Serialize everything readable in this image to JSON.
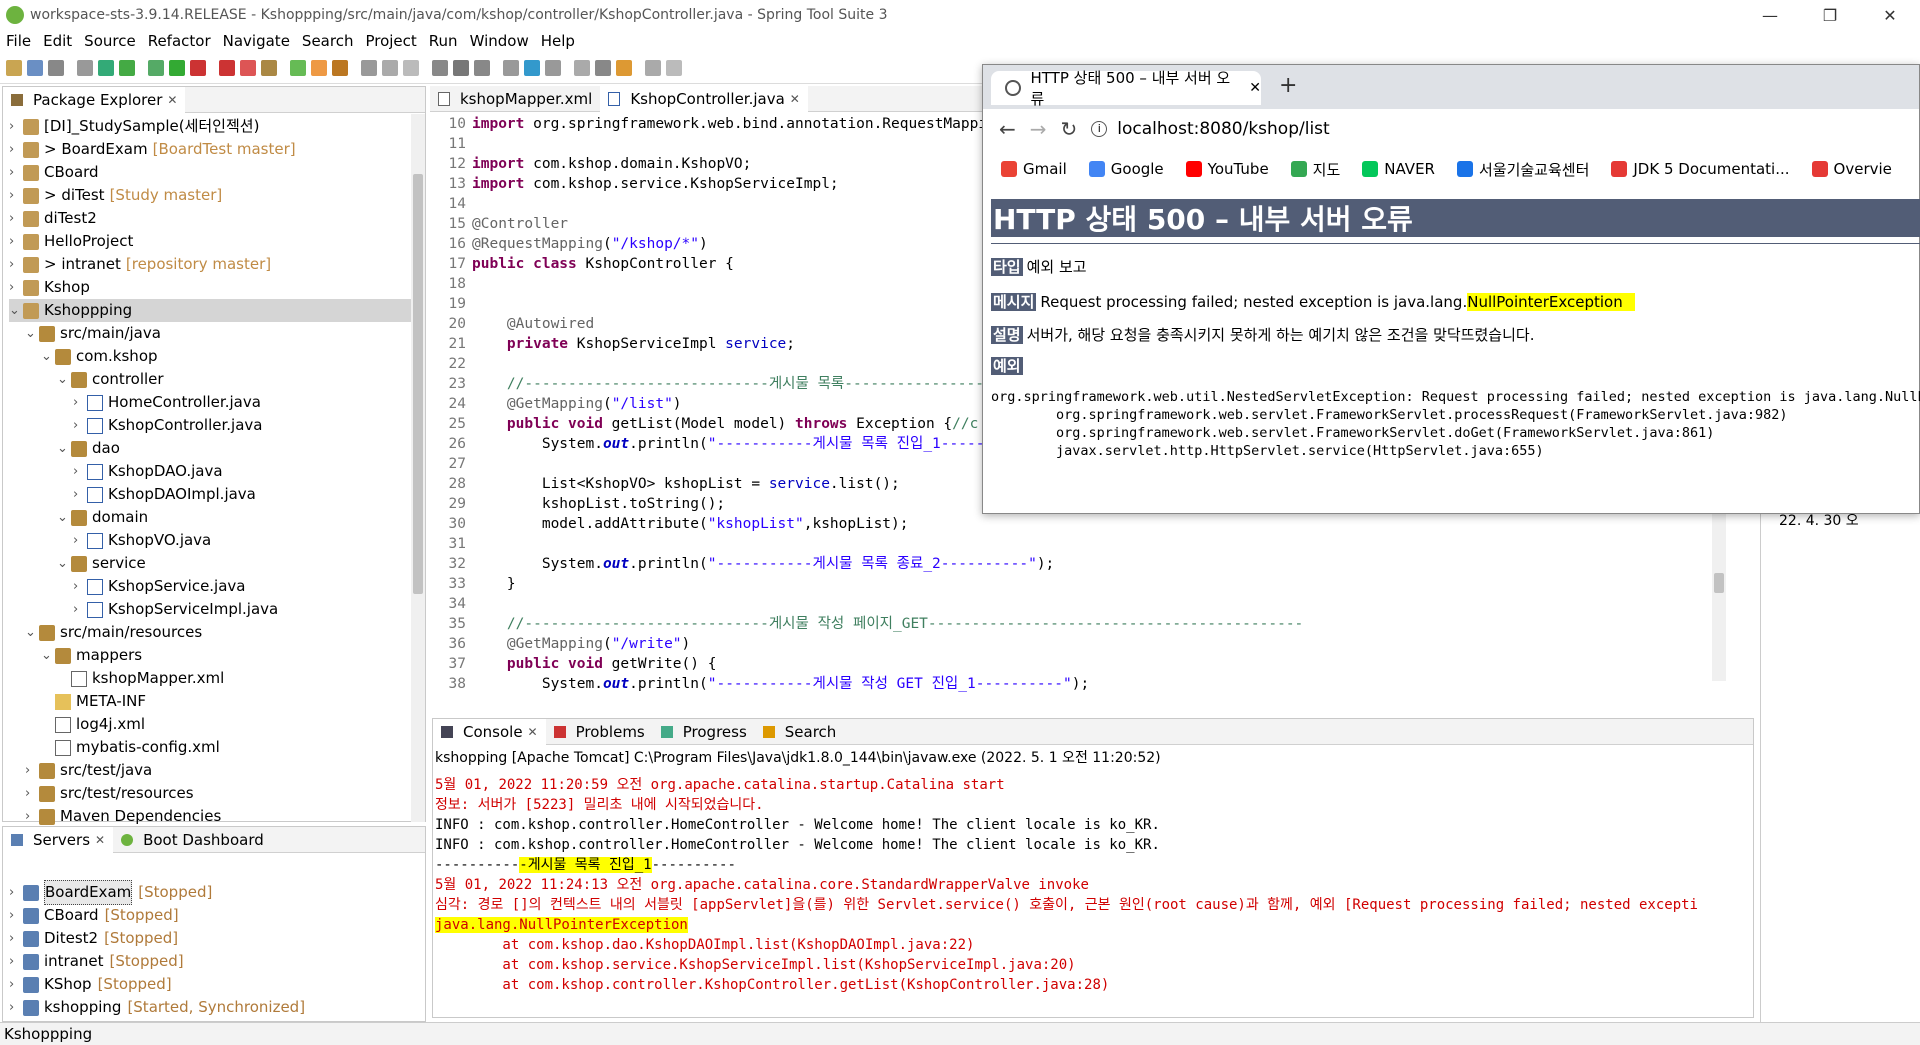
{
  "window": {
    "title": "workspace-sts-3.9.14.RELEASE - Kshoppping/src/main/java/com/kshop/controller/KshopController.java - Spring Tool Suite 3"
  },
  "menu": [
    "File",
    "Edit",
    "Source",
    "Refactor",
    "Navigate",
    "Search",
    "Project",
    "Run",
    "Window",
    "Help"
  ],
  "package_explorer": {
    "title": "Package Explorer",
    "items": [
      {
        "label": "[DI]_StudySample(세터인젝션)",
        "extra": "",
        "indent": 0,
        "arrow": "›",
        "icon": "proj"
      },
      {
        "label": "> BoardExam",
        "extra": "[BoardTest master]",
        "indent": 0,
        "arrow": "›",
        "icon": "proj"
      },
      {
        "label": "CBoard",
        "extra": "",
        "indent": 0,
        "arrow": "›",
        "icon": "proj"
      },
      {
        "label": "> diTest",
        "extra": "[Study master]",
        "indent": 0,
        "arrow": "›",
        "icon": "proj"
      },
      {
        "label": "diTest2",
        "extra": "",
        "indent": 0,
        "arrow": "›",
        "icon": "proj"
      },
      {
        "label": "HelloProject",
        "extra": "",
        "indent": 0,
        "arrow": "›",
        "icon": "proj"
      },
      {
        "label": "> intranet",
        "extra": "[repository master]",
        "indent": 0,
        "arrow": "›",
        "icon": "proj"
      },
      {
        "label": "Kshop",
        "extra": "",
        "indent": 0,
        "arrow": "›",
        "icon": "proj"
      },
      {
        "label": "Kshoppping",
        "extra": "",
        "indent": 0,
        "arrow": "⌄",
        "icon": "proj",
        "selected": true
      },
      {
        "label": "src/main/java",
        "extra": "",
        "indent": 1,
        "arrow": "⌄",
        "icon": "pkg"
      },
      {
        "label": "com.kshop",
        "extra": "",
        "indent": 2,
        "arrow": "⌄",
        "icon": "pkg"
      },
      {
        "label": "controller",
        "extra": "",
        "indent": 3,
        "arrow": "⌄",
        "icon": "pkg"
      },
      {
        "label": "HomeController.java",
        "extra": "",
        "indent": 4,
        "arrow": "›",
        "icon": "file"
      },
      {
        "label": "KshopController.java",
        "extra": "",
        "indent": 4,
        "arrow": "›",
        "icon": "file"
      },
      {
        "label": "dao",
        "extra": "",
        "indent": 3,
        "arrow": "⌄",
        "icon": "pkg"
      },
      {
        "label": "KshopDAO.java",
        "extra": "",
        "indent": 4,
        "arrow": "›",
        "icon": "file"
      },
      {
        "label": "KshopDAOImpl.java",
        "extra": "",
        "indent": 4,
        "arrow": "›",
        "icon": "file"
      },
      {
        "label": "domain",
        "extra": "",
        "indent": 3,
        "arrow": "⌄",
        "icon": "pkg"
      },
      {
        "label": "KshopVO.java",
        "extra": "",
        "indent": 4,
        "arrow": "›",
        "icon": "file"
      },
      {
        "label": "service",
        "extra": "",
        "indent": 3,
        "arrow": "⌄",
        "icon": "pkg"
      },
      {
        "label": "KshopService.java",
        "extra": "",
        "indent": 4,
        "arrow": "›",
        "icon": "file"
      },
      {
        "label": "KshopServiceImpl.java",
        "extra": "",
        "indent": 4,
        "arrow": "›",
        "icon": "file"
      },
      {
        "label": "src/main/resources",
        "extra": "",
        "indent": 1,
        "arrow": "⌄",
        "icon": "pkg"
      },
      {
        "label": "mappers",
        "extra": "",
        "indent": 2,
        "arrow": "⌄",
        "icon": "pkg"
      },
      {
        "label": "kshopMapper.xml",
        "extra": "",
        "indent": 3,
        "arrow": "",
        "icon": "xml"
      },
      {
        "label": "META-INF",
        "extra": "",
        "indent": 2,
        "arrow": "",
        "icon": "folder"
      },
      {
        "label": "log4j.xml",
        "extra": "",
        "indent": 2,
        "arrow": "",
        "icon": "xml"
      },
      {
        "label": "mybatis-config.xml",
        "extra": "",
        "indent": 2,
        "arrow": "",
        "icon": "xml"
      },
      {
        "label": "src/test/java",
        "extra": "",
        "indent": 1,
        "arrow": "›",
        "icon": "pkg"
      },
      {
        "label": "src/test/resources",
        "extra": "",
        "indent": 1,
        "arrow": "›",
        "icon": "pkg"
      },
      {
        "label": "Maven Dependencies",
        "extra": "",
        "indent": 1,
        "arrow": "›",
        "icon": "pkg"
      }
    ]
  },
  "servers": {
    "tabs": [
      "Servers",
      "Boot Dashboard"
    ],
    "items": [
      {
        "label": "BoardExam",
        "status": "[Stopped]",
        "selected": true
      },
      {
        "label": "CBoard",
        "status": "[Stopped]"
      },
      {
        "label": "Ditest2",
        "status": "[Stopped]"
      },
      {
        "label": "intranet",
        "status": "[Stopped]"
      },
      {
        "label": "KShop",
        "status": "[Stopped]"
      },
      {
        "label": "kshopping",
        "status": "[Started, Synchronized]"
      }
    ]
  },
  "editor": {
    "tabs": [
      "kshopMapper.xml",
      "KshopController.java"
    ],
    "lines": [
      {
        "n": "10",
        "h": "<span class='kw'>import</span> org.springframework.web.bind.annotation.RequestMapping;"
      },
      {
        "n": "11",
        "h": ""
      },
      {
        "n": "12",
        "h": "<span class='kw'>import</span> com.kshop.domain.KshopVO;"
      },
      {
        "n": "13",
        "h": "<span class='kw'>import</span> com.kshop.service.KshopServiceImpl;"
      },
      {
        "n": "14",
        "h": ""
      },
      {
        "n": "15",
        "h": "<span class='an'>@Controller</span>"
      },
      {
        "n": "16",
        "h": "<span class='an'>@RequestMapping</span>(<span class='str'>\"/kshop/*\"</span>)"
      },
      {
        "n": "17",
        "h": "<span class='kw'>public class</span> KshopController {"
      },
      {
        "n": "18",
        "h": ""
      },
      {
        "n": "19",
        "h": ""
      },
      {
        "n": "20",
        "h": "    <span class='an'>@Autowired</span>"
      },
      {
        "n": "21",
        "h": "    <span class='kw'>private</span> KshopServiceImpl <span class='fld'>service</span>;"
      },
      {
        "n": "22",
        "h": ""
      },
      {
        "n": "23",
        "h": "    <span class='cm'>//----------------------------게시물 목록-------------------------------------------</span>"
      },
      {
        "n": "24",
        "h": "    <span class='an'>@GetMapping</span>(<span class='str'>\"/list\"</span>)"
      },
      {
        "n": "25",
        "h": "    <span class='kw'>public void</span> getList(Model model) <span class='kw'>throws</span> Exception {<span class='cm'>//c</span>"
      },
      {
        "n": "26",
        "h": "        System.<span class='it'>out</span>.println(<span class='str'>\"-----------게시물 목록 진입_1-----</span>"
      },
      {
        "n": "27",
        "h": ""
      },
      {
        "n": "28",
        "h": "        List&lt;KshopVO&gt; kshopList = <span class='fld'>service</span>.list();"
      },
      {
        "n": "29",
        "h": "        kshopList.toString();"
      },
      {
        "n": "30",
        "h": "        model.addAttribute(<span class='str'>\"kshopList\"</span>,kshopList);"
      },
      {
        "n": "31",
        "h": ""
      },
      {
        "n": "32",
        "h": "        System.<span class='it'>out</span>.println(<span class='str'>\"-----------게시물 목록 종료_2----------\"</span>);"
      },
      {
        "n": "33",
        "h": "    }"
      },
      {
        "n": "34",
        "h": ""
      },
      {
        "n": "35",
        "h": "    <span class='cm'>//----------------------------게시물 작성 페이지_GET-------------------------------------------</span>"
      },
      {
        "n": "36",
        "h": "    <span class='an'>@GetMapping</span>(<span class='str'>\"/write\"</span>)"
      },
      {
        "n": "37",
        "h": "    <span class='kw'>public void</span> getWrite() {"
      },
      {
        "n": "38",
        "h": "        System.<span class='it'>out</span>.println(<span class='str'>\"-----------게시물 작성 GET 진입_1----------\"</span>);"
      }
    ]
  },
  "console": {
    "tabs": [
      "Console",
      "Problems",
      "Progress",
      "Search"
    ],
    "header": "kshopping [Apache Tomcat] C:\\Program Files\\Java\\jdk1.8.0_144\\bin\\javaw.exe  (2022. 5. 1 오전 11:20:52)",
    "lines": [
      {
        "cls": "red",
        "t": "5월 01, 2022 11:20:59 오전 org.apache.catalina.startup.Catalina start"
      },
      {
        "cls": "red",
        "t": "정보: 서버가 [5223] 밀리초 내에 시작되었습니다."
      },
      {
        "cls": "",
        "t": "INFO : com.kshop.controller.HomeController - Welcome home! The client locale is ko_KR."
      },
      {
        "cls": "",
        "t": "INFO : com.kshop.controller.HomeController - Welcome home! The client locale is ko_KR."
      },
      {
        "cls": "",
        "h": "----------<span class='hl'>-게시물 목록 진입_1</span>----------"
      },
      {
        "cls": "red",
        "t": "5월 01, 2022 11:24:13 오전 org.apache.catalina.core.StandardWrapperValve invoke"
      },
      {
        "cls": "red",
        "t": "심각: 경로 []의 컨텍스트 내의 서블릿 [appServlet]을(를) 위한 Servlet.service() 호출이, 근본 원인(root cause)과 함께, 예외 [Request processing failed; nested excepti"
      },
      {
        "cls": "red",
        "h": "<span class='hl'>java.lang.NullPointerException</span>"
      },
      {
        "cls": "red",
        "t": "        at com.kshop.dao.KshopDAOImpl.list(KshopDAOImpl.java:22)"
      },
      {
        "cls": "red",
        "t": "        at com.kshop.service.KshopServiceImpl.list(KshopServiceImpl.java:20)"
      },
      {
        "cls": "red",
        "t": "        at com.kshop.controller.KshopController.getList(KshopController.java:28)"
      }
    ]
  },
  "browser": {
    "tab_title": "HTTP 상태 500 – 내부 서버 오류",
    "url": "localhost:8080/kshop/list",
    "bookmarks": [
      {
        "label": "Gmail",
        "color": "#ea4335"
      },
      {
        "label": "Google",
        "color": "#4285f4"
      },
      {
        "label": "YouTube",
        "color": "#ff0000"
      },
      {
        "label": "지도",
        "color": "#34a853"
      },
      {
        "label": "NAVER",
        "color": "#03c75a"
      },
      {
        "label": "서울기술교육센터",
        "color": "#1a73e8"
      },
      {
        "label": "JDK 5 Documentati...",
        "color": "#e53935"
      },
      {
        "label": "Overvie",
        "color": "#e53935"
      }
    ],
    "error_title": "HTTP 상태 500 – 내부 서버 오류",
    "type_label": "타입",
    "type_value": "예외 보고",
    "msg_label": "메시지",
    "msg_value": "Request processing failed; nested exception is java.lang.",
    "msg_highlight": "NullPointerException",
    "desc_label": "설명",
    "desc_value": "서버가, 해당 요청을 충족시키지 못하게 하는 예기치 않은 조건을 맞닥뜨렸습니다.",
    "exc_label": "예외",
    "stack": [
      "org.springframework.web.util.NestedServletException: Request processing failed; nested exception is java.lang.NullPo",
      "        org.springframework.web.servlet.FrameworkServlet.processRequest(FrameworkServlet.java:982)",
      "        org.springframework.web.servlet.FrameworkServlet.doGet(FrameworkServlet.java:861)",
      "        javax.servlet.http.HttpServlet.service(HttpServlet.java:655)"
    ]
  },
  "outline_text": "22. 4. 30 오",
  "status_bar": "Kshoppping"
}
